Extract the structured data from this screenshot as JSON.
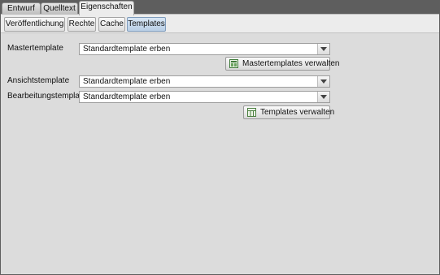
{
  "tabs": [
    {
      "label": "Entwurf"
    },
    {
      "label": "Quelltext"
    },
    {
      "label": "Eigenschaften"
    }
  ],
  "subtabs": [
    {
      "label": "Veröffentlichung"
    },
    {
      "label": "Rechte"
    },
    {
      "label": "Cache"
    },
    {
      "label": "Templates"
    }
  ],
  "active_tab": "Eigenschaften",
  "active_subtab": "Templates",
  "form": {
    "master": {
      "label": "Mastertemplate",
      "value": "Standardtemplate erben"
    },
    "master_button": {
      "label": "Mastertemplates verwalten",
      "icon": "master-template-icon"
    },
    "view": {
      "label": "Ansichtstemplate",
      "value": "Standardtemplate erben"
    },
    "edit": {
      "label": "Bearbeitungstemplate",
      "value": "Standardtemplate erben"
    },
    "templates_button": {
      "label": "Templates verwalten",
      "icon": "template-grid-icon"
    }
  },
  "colors": {
    "active_subtab": "#b9cfe6",
    "panel": "#dcdcdc",
    "frame": "#5e5e5e"
  }
}
